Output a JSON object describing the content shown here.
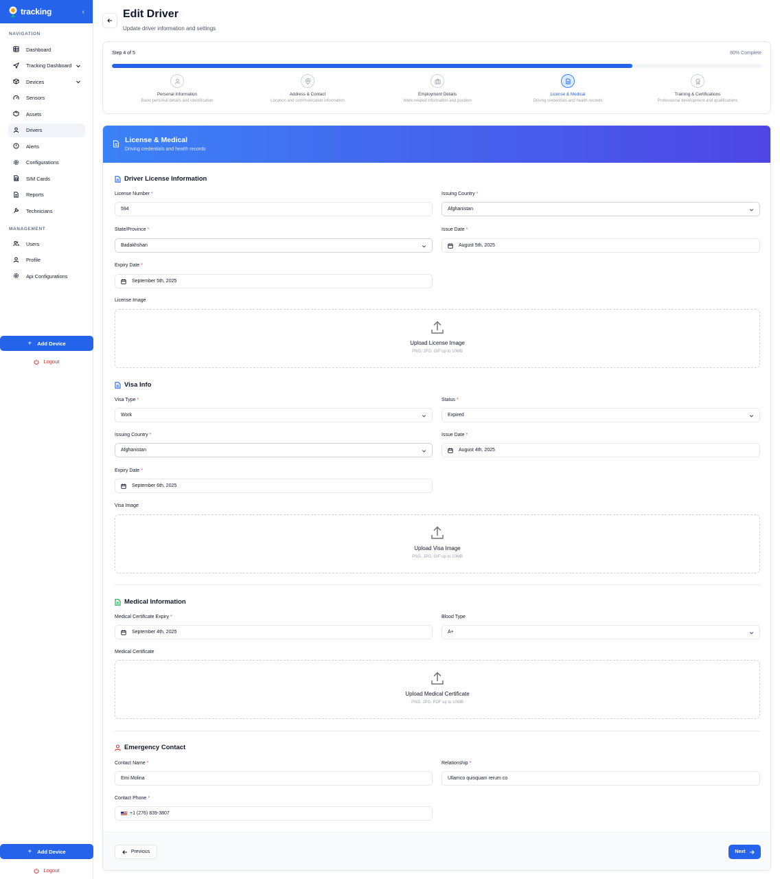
{
  "sidebar": {
    "brand": "tracking",
    "section_navigation": "NAVIGATION",
    "section_management": "MANAGEMENT",
    "nav": [
      {
        "label": "Dashboard",
        "icon": "grid-icon"
      },
      {
        "label": "Tracking Dashboard",
        "icon": "navigation-icon",
        "expandable": true
      },
      {
        "label": "Devices",
        "icon": "cube-icon",
        "expandable": true
      },
      {
        "label": "Sensors",
        "icon": "gauge-icon"
      },
      {
        "label": "Assets",
        "icon": "package-icon"
      },
      {
        "label": "Drivers",
        "icon": "user-icon",
        "active": true
      },
      {
        "label": "Alerts",
        "icon": "alert-circle-icon"
      },
      {
        "label": "Configurations",
        "icon": "gear-icon"
      },
      {
        "label": "SIM Cards",
        "icon": "chip-icon"
      },
      {
        "label": "Reports",
        "icon": "file-icon"
      },
      {
        "label": "Technicians",
        "icon": "wrench-icon"
      }
    ],
    "management": [
      {
        "label": "Users",
        "icon": "users-icon"
      },
      {
        "label": "Profile",
        "icon": "user-icon"
      },
      {
        "label": "Api Configurations",
        "icon": "gear-icon"
      }
    ],
    "add_device": "Add Device",
    "logout": "Logout"
  },
  "page": {
    "title": "Edit Driver",
    "subtitle": "Update driver information and settings"
  },
  "wizard": {
    "step_text": "Step 4 of 5",
    "percent_text": "80% Complete",
    "progress": 0.8,
    "steps": [
      {
        "title": "Personal Information",
        "desc": "Basic personal details and identification",
        "icon": "user-icon"
      },
      {
        "title": "Address & Contact",
        "desc": "Location and communication information",
        "icon": "map-pin-icon"
      },
      {
        "title": "Employment Details",
        "desc": "Work-related information and position",
        "icon": "briefcase-icon"
      },
      {
        "title": "License & Medical",
        "desc": "Driving credentials and health records",
        "icon": "document-icon",
        "active": true
      },
      {
        "title": "Training & Certifications",
        "desc": "Professional development and qualifications",
        "icon": "award-icon"
      }
    ]
  },
  "form": {
    "header_title": "License & Medical",
    "header_sub": "Driving credentials and health records",
    "license": {
      "title": "Driver License Information",
      "number_label": "License Number",
      "number_value": "594",
      "country_label": "Issuing Country",
      "country_value": "Afghanistan",
      "state_label": "State/Province",
      "state_value": "Badakhshan",
      "issue_label": "Issue Date",
      "issue_value": "August 5th, 2025",
      "expiry_label": "Expiry Date",
      "expiry_value": "September 5th, 2025",
      "image_label": "License Image",
      "upload_title": "Upload License Image",
      "upload_hint": "PNG, JPG, GIF up to 10MB"
    },
    "visa": {
      "title": "Visa Info",
      "type_label": "Visa Type",
      "type_value": "Work",
      "status_label": "Status",
      "status_value": "Expired",
      "country_label": "Issuing Country",
      "country_value": "Afghanistan",
      "issue_label": "Issue Date",
      "issue_value": "August 4th, 2025",
      "expiry_label": "Expiry Date",
      "expiry_value": "September 6th, 2025",
      "image_label": "Visa Image",
      "upload_title": "Upload Visa Image",
      "upload_hint": "PNG, JPG, GIF up to 10MB"
    },
    "medical": {
      "title": "Medical Information",
      "cert_expiry_label": "Medical Certificate Expiry",
      "cert_expiry_value": "September 4th, 2025",
      "blood_label": "Blood Type",
      "blood_value": "A+",
      "cert_label": "Medical Certificate",
      "upload_title": "Upload Medical Certificate",
      "upload_hint": "PNG, JPG, PDF up to 10MB"
    },
    "emergency": {
      "title": "Emergency Contact",
      "name_label": "Contact Name",
      "name_value": "Emi Molina",
      "relationship_label": "Relationship",
      "relationship_value": "Ullamco quisquam rerum co",
      "phone_label": "Contact Phone",
      "phone_value": "+1 (276) 839-3807"
    },
    "prev_label": "Previous",
    "next_label": "Next"
  },
  "colors": {
    "primary": "#2563eb",
    "header_gradient_start": "#3b82f6",
    "header_gradient_end": "#4f46e5",
    "required": "#ef4444",
    "logout": "#dc2626",
    "medical_icon": "#16a34a",
    "emergency_icon": "#dc2626"
  }
}
